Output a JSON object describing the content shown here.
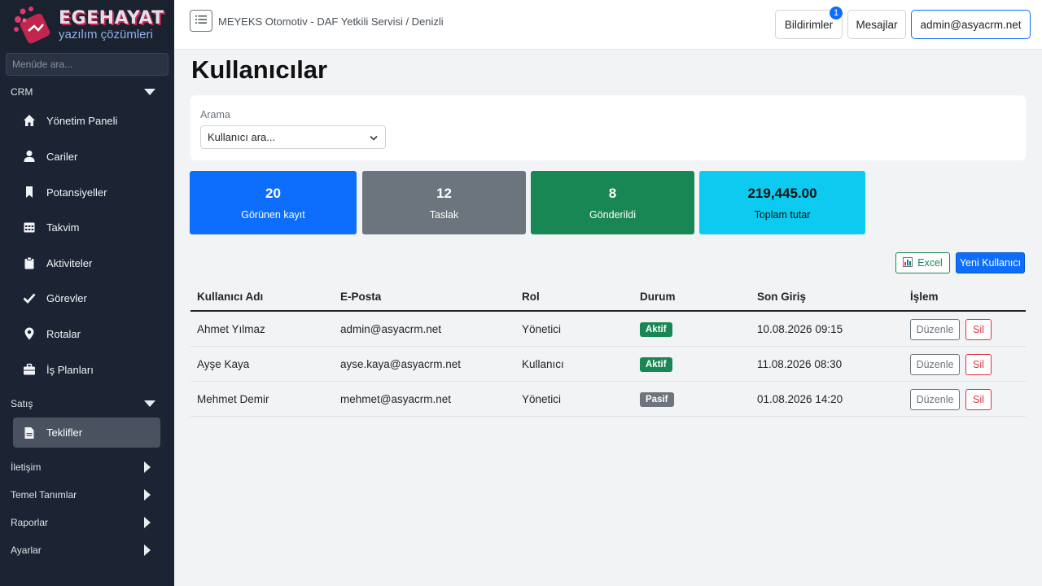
{
  "sidebar": {
    "logo_title": "EGEHAYAT",
    "logo_subtitle": "yazılım çözümleri",
    "search_placeholder": "Menüde ara...",
    "groups": [
      {
        "label": "CRM",
        "state": "expanded"
      },
      {
        "label": "Satış",
        "state": "expanded"
      },
      {
        "label": "İletişim",
        "state": "collapsed"
      },
      {
        "label": "Temel Tanımlar",
        "state": "collapsed"
      },
      {
        "label": "Raporlar",
        "state": "collapsed"
      },
      {
        "label": "Ayarlar",
        "state": "collapsed"
      }
    ],
    "items": [
      {
        "label": "Yönetim Paneli",
        "icon": "home-icon"
      },
      {
        "label": "Cariler",
        "icon": "user-icon"
      },
      {
        "label": "Potansiyeller",
        "icon": "bookmark-icon"
      },
      {
        "label": "Takvim",
        "icon": "calendar-icon"
      },
      {
        "label": "Aktiviteler",
        "icon": "clipboard-icon"
      },
      {
        "label": "Görevler",
        "icon": "check-icon"
      },
      {
        "label": "Rotalar",
        "icon": "map-pin-icon"
      },
      {
        "label": "İş Planları",
        "icon": "briefcase-icon"
      },
      {
        "label": "Teklifler",
        "icon": "document-icon",
        "active": true
      }
    ]
  },
  "header": {
    "title": "MEYEKS Otomotiv - DAF Yetkili Servisi / Denizli",
    "notifications_label": "Bildirimler",
    "notifications_count": "1",
    "messages_label": "Mesajlar",
    "user_label": "admin@asyacrm.net"
  },
  "main": {
    "page_title": "Kullanıcılar",
    "search": {
      "label": "Arama",
      "value": "Kullanıcı ara..."
    },
    "stats": [
      {
        "value": "20",
        "label": "Görünen kayıt",
        "color": "#0d6efd"
      },
      {
        "value": "12",
        "label": "Taslak",
        "color": "#6c757d"
      },
      {
        "value": "8",
        "label": "Gönderildi",
        "color": "#198754"
      },
      {
        "value": "219,445.00",
        "label": "Toplam tutar",
        "color": "#0dcaf0"
      }
    ],
    "excel_label": "Excel",
    "new_user_label": "Yeni Kullanıcı",
    "table": {
      "columns": [
        "Kullanıcı Adı",
        "E-Posta",
        "Rol",
        "Durum",
        "Son Giriş",
        "İşlem"
      ],
      "rows": [
        {
          "name": "Ahmet Yılmaz",
          "email": "admin@asyacrm.net",
          "role": "Yönetici",
          "status": "Aktif",
          "status_color": "#198754",
          "last_login": "10.08.2026 09:15"
        },
        {
          "name": "Ayşe Kaya",
          "email": "ayse.kaya@asyacrm.net",
          "role": "Kullanıcı",
          "status": "Aktif",
          "status_color": "#198754",
          "last_login": "11.08.2026 08:30"
        },
        {
          "name": "Mehmet Demir",
          "email": "mehmet@asyacrm.net",
          "role": "Yönetici",
          "status": "Pasif",
          "status_color": "#6c757d",
          "last_login": "01.08.2026 14:20"
        }
      ],
      "edit_label": "Düzenle",
      "delete_label": "Sil"
    }
  }
}
